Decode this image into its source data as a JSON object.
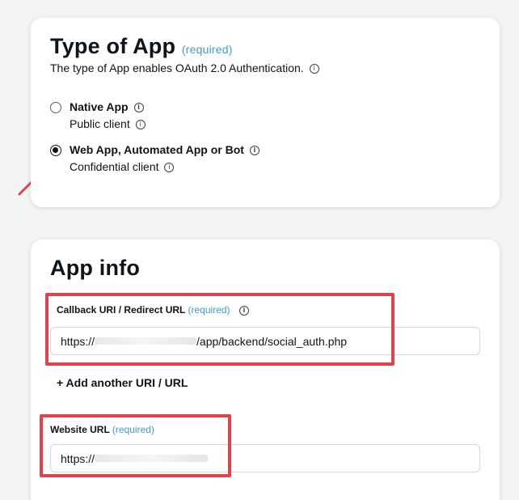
{
  "type_of_app": {
    "title": "Type of App",
    "required": "(required)",
    "description": "The type of App enables OAuth 2.0 Authentication.",
    "options": [
      {
        "label": "Native App",
        "sub": "Public client",
        "selected": false
      },
      {
        "label": "Web App, Automated App or Bot",
        "sub": "Confidential client",
        "selected": true
      }
    ]
  },
  "app_info": {
    "title": "App info",
    "callback": {
      "label": "Callback URI / Redirect URL",
      "required": "(required)",
      "value_prefix": "https://",
      "value_suffix": "/app/backend/social_auth.php"
    },
    "add_another": "+ Add another URI / URL",
    "website": {
      "label": "Website URL",
      "required": "(required)",
      "value_prefix": "https://"
    }
  },
  "colors": {
    "accent": "#3d9ad6",
    "highlight": "#e3424d"
  },
  "icons": {
    "info": "info-icon",
    "arrow": "pointer-arrow-icon"
  }
}
